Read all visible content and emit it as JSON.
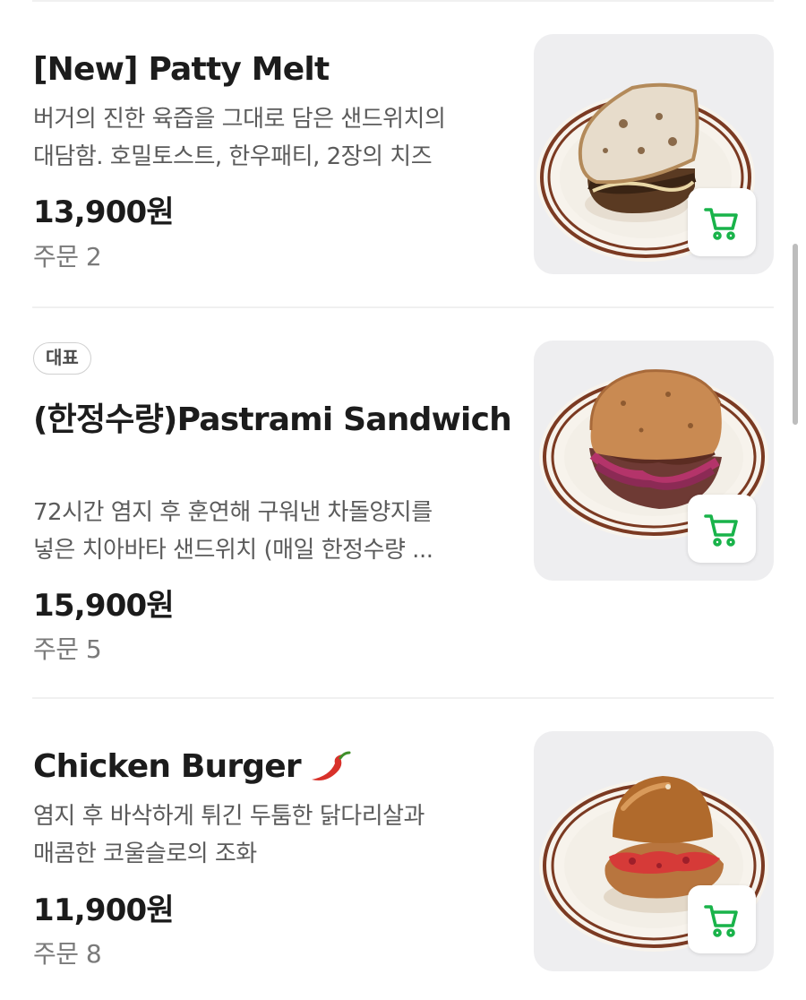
{
  "menu": {
    "items": [
      {
        "badge": "",
        "name": "[New] Patty Melt",
        "desc_line1": "버거의 진한 육즙을 그대로 담은 샌드위치의",
        "desc_line2": "대담함. 호밀토스트, 한우패티, 2장의 치즈",
        "price": "13,900원",
        "orders": "주문 2",
        "image": "patty-melt-photo"
      },
      {
        "badge": "대표",
        "name": "(한정수량)Pastrami Sandwich",
        "desc_line1": "72시간 염지 후 훈연해 구워낸 차돌양지를",
        "desc_line2": "넣은 치아바타 샌드위치 (매일 한정수량 ...",
        "price": "15,900원",
        "orders": "주문 5",
        "image": "pastrami-sandwich-photo"
      },
      {
        "badge": "",
        "name": "Chicken Burger",
        "name_icon": "chili-pepper-icon",
        "desc_line1": "염지 후 바삭하게 튀긴 두툼한 닭다리살과",
        "desc_line2": "매콤한 코울슬로의 조화",
        "price": "11,900원",
        "orders": "주문 8",
        "image": "chicken-burger-photo"
      }
    ]
  },
  "icons": {
    "cart": "cart-icon"
  },
  "colors": {
    "cart_green": "#19b34a",
    "plate_rim": "#7b3a22",
    "spicy_red": "#d8312a"
  }
}
